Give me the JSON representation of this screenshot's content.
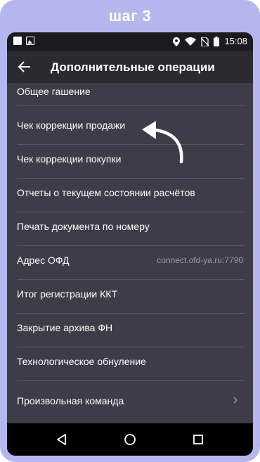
{
  "step_title": "шаг 3",
  "status_bar": {
    "time": "15:08"
  },
  "app_bar": {
    "title": "Дополнительные операции",
    "back_icon": "arrow-left-icon"
  },
  "menu_items": [
    {
      "label": "Общее гашение"
    },
    {
      "label": "Чек коррекции продажи"
    },
    {
      "label": "Чек коррекции покупки"
    },
    {
      "label": "Отчеты о текущем состоянии расчётов"
    },
    {
      "label": "Печать документа по номеру"
    },
    {
      "label": "Адрес ОФД",
      "value": "connect.ofd-ya.ru:7790"
    },
    {
      "label": "Итог регистрации ККТ"
    },
    {
      "label": "Закрытие архива ФН"
    },
    {
      "label": "Технологическое обнуление"
    },
    {
      "label": "Произвольная команда",
      "icon": "chevron-right-icon"
    }
  ],
  "colors": {
    "frame": "#b6b6ee",
    "screen_background": "#3d3c48",
    "app_bar": "#2a2a30",
    "status_bar": "#1b1b1f",
    "nav_bar": "#000000",
    "divider": "#5b5a67"
  }
}
